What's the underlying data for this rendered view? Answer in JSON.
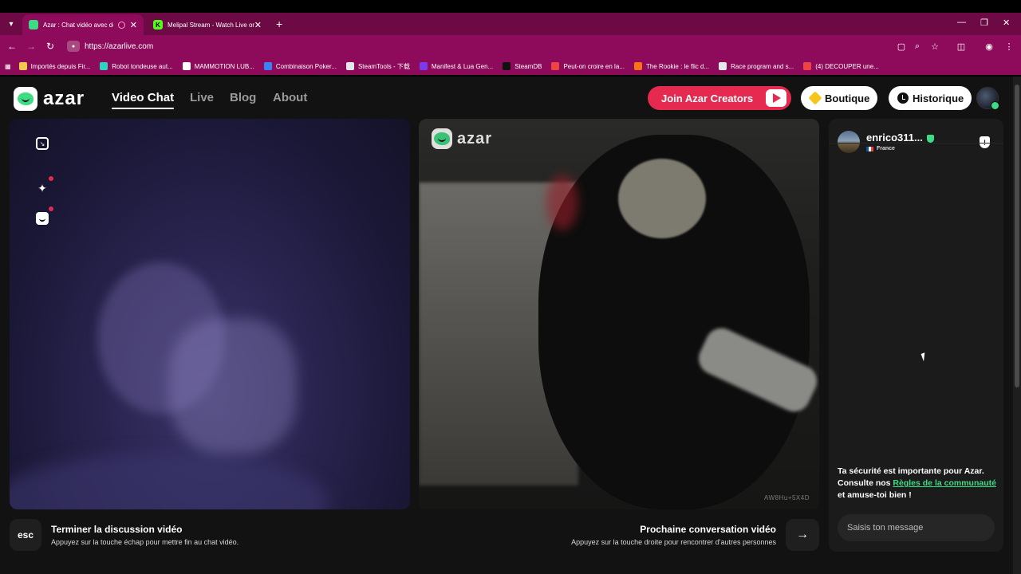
{
  "browser": {
    "tabs": [
      {
        "title": "Azar : Chat vidéo avec de n",
        "favicon_color": "#3ddc84",
        "active": true
      },
      {
        "title": "Melipal Stream - Watch Live on",
        "favicon_color": "#53fc18",
        "favicon_letter": "K",
        "active": false
      }
    ],
    "url": "https://azarlive.com",
    "bookmarks": [
      {
        "label": "Importés depuis Fir...",
        "color": "#f2c94c"
      },
      {
        "label": "Robot tondeuse aut...",
        "color": "#2dd4bf"
      },
      {
        "label": "MAMMOTION LUB...",
        "color": "#ffffff"
      },
      {
        "label": "Combinaison Poker...",
        "color": "#3b82f6"
      },
      {
        "label": "SteamTools - 下载",
        "color": "#e5e7eb"
      },
      {
        "label": "Manifest & Lua Gen...",
        "color": "#7c3aed"
      },
      {
        "label": "SteamDB",
        "color": "#111111"
      },
      {
        "label": "Peut-on croire en la...",
        "color": "#ef4444"
      },
      {
        "label": "The Rookie : le flic d...",
        "color": "#f97316"
      },
      {
        "label": "Race program and s...",
        "color": "#e5e7eb"
      },
      {
        "label": "(4) DECOUPER une...",
        "color": "#ef4444"
      }
    ]
  },
  "header": {
    "logo_text": "azar",
    "nav": [
      "Video Chat",
      "Live",
      "Blog",
      "About"
    ],
    "creators_label": "Join Azar Creators",
    "boutique_label": "Boutique",
    "historique_label": "Historique"
  },
  "video": {
    "watermark": "azar",
    "code": "AW8Hu+5X4D"
  },
  "controls": {
    "esc_key": "esc",
    "end_title": "Terminer la discussion vidéo",
    "end_sub": "Appuyez sur la touche échap pour mettre fin au chat vidéo.",
    "next_title": "Prochaine conversation vidéo",
    "next_sub": "Appuyez sur la touche droite pour rencontrer d'autres personnes"
  },
  "chat": {
    "peer_name": "enrico311...",
    "peer_country": "France",
    "safety_part1": "Ta sécurité est importante pour Azar. Consulte nos ",
    "safety_link": "Règles de la communauté",
    "safety_part2": " et amuse-toi bien !",
    "input_placeholder": "Saisis ton message"
  },
  "colors": {
    "brand_green": "#3ddc84",
    "creators_red": "#e5294f",
    "chrome_magenta": "#8e0b5c"
  }
}
